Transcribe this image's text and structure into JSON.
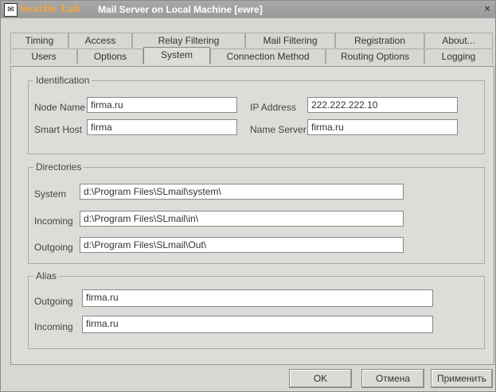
{
  "window": {
    "title_brand": "Seattle Lab",
    "title": "Mail Server on Local Machine [ewre]",
    "close_glyph": "×",
    "icon": "app-icon"
  },
  "tabs_back": [
    "Timing",
    "Access",
    "Relay Filtering",
    "Mail Filtering",
    "Registration",
    "About..."
  ],
  "tabs_front": [
    "Users",
    "Options",
    "System",
    "Connection Method",
    "Routing Options",
    "Logging"
  ],
  "active_tab": "System",
  "identification": {
    "label": "Identification",
    "node_name_label": "Node Name",
    "node_name_value": "firma.ru",
    "ip_address_label": "IP Address",
    "ip_address_value": "222.222.222.10",
    "smart_host_label": "Smart Host",
    "smart_host_value": "firma",
    "name_server_label": "Name Server",
    "name_server_value": "firma.ru"
  },
  "directories": {
    "label": "Directories",
    "system_label": "System",
    "system_value": "d:\\Program Files\\SLmail\\system\\",
    "incoming_label": "Incoming",
    "incoming_value": "d:\\Program Files\\SLmail\\in\\",
    "outgoing_label": "Outgoing",
    "outgoing_value": "d:\\Program Files\\SLmail\\Out\\"
  },
  "alias": {
    "label": "Alias",
    "outgoing_label": "Outgoing",
    "outgoing_value": "firma.ru",
    "incoming_label": "Incoming",
    "incoming_value": "firma.ru"
  },
  "buttons": {
    "ok": "OK",
    "cancel": "Отмена",
    "apply": "Применить"
  }
}
